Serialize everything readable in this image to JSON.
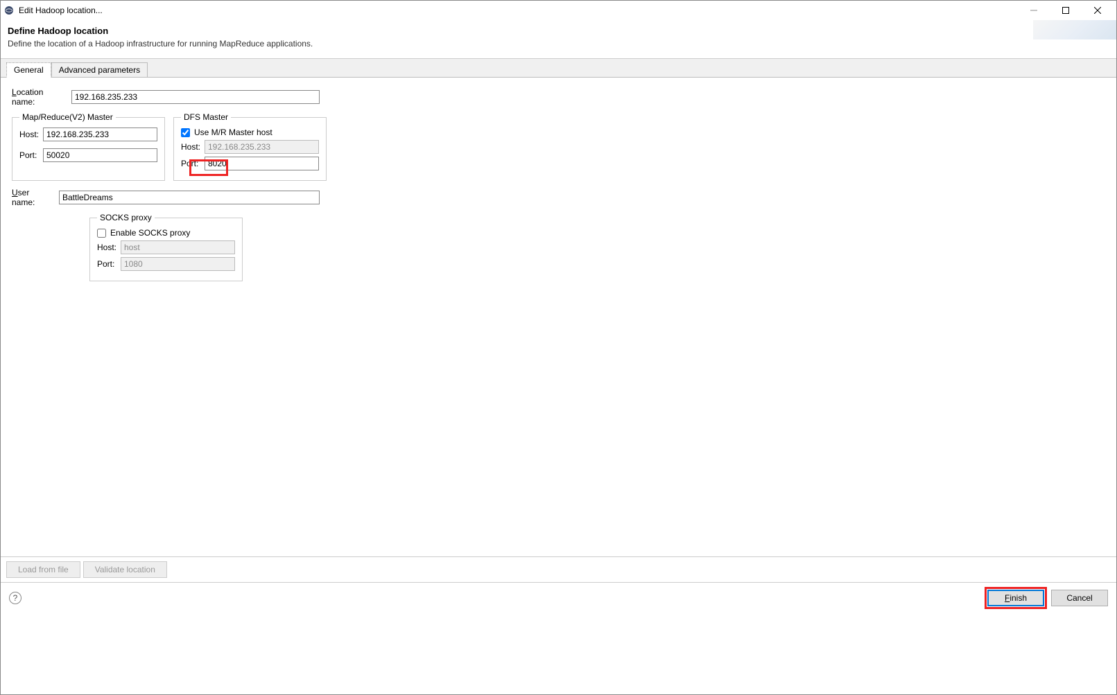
{
  "window": {
    "title": "Edit Hadoop location..."
  },
  "header": {
    "heading": "Define Hadoop location",
    "subheading": "Define the location of a Hadoop infrastructure for running MapReduce applications."
  },
  "tabs": {
    "general": "General",
    "advanced": "Advanced parameters"
  },
  "form": {
    "location_name_label": "Location name:",
    "location_name_value": "192.168.235.233",
    "mr_master": {
      "legend": "Map/Reduce(V2) Master",
      "host_label": "Host:",
      "host_value": "192.168.235.233",
      "port_label": "Port:",
      "port_value": "50020"
    },
    "dfs_master": {
      "legend": "DFS Master",
      "use_mr_host_label": "Use M/R Master host",
      "use_mr_host_checked": true,
      "host_label": "Host:",
      "host_value": "192.168.235.233",
      "port_label": "Port:",
      "port_value": "8020"
    },
    "user_name_label": "User name:",
    "user_name_value": "BattleDreams",
    "socks": {
      "legend": "SOCKS proxy",
      "enable_label": "Enable SOCKS proxy",
      "enable_checked": false,
      "host_label": "Host:",
      "host_placeholder": "host",
      "port_label": "Port:",
      "port_value": "1080"
    }
  },
  "buttons": {
    "load_from_file": "Load from file",
    "validate_location": "Validate location",
    "finish": "Finish",
    "cancel": "Cancel"
  }
}
